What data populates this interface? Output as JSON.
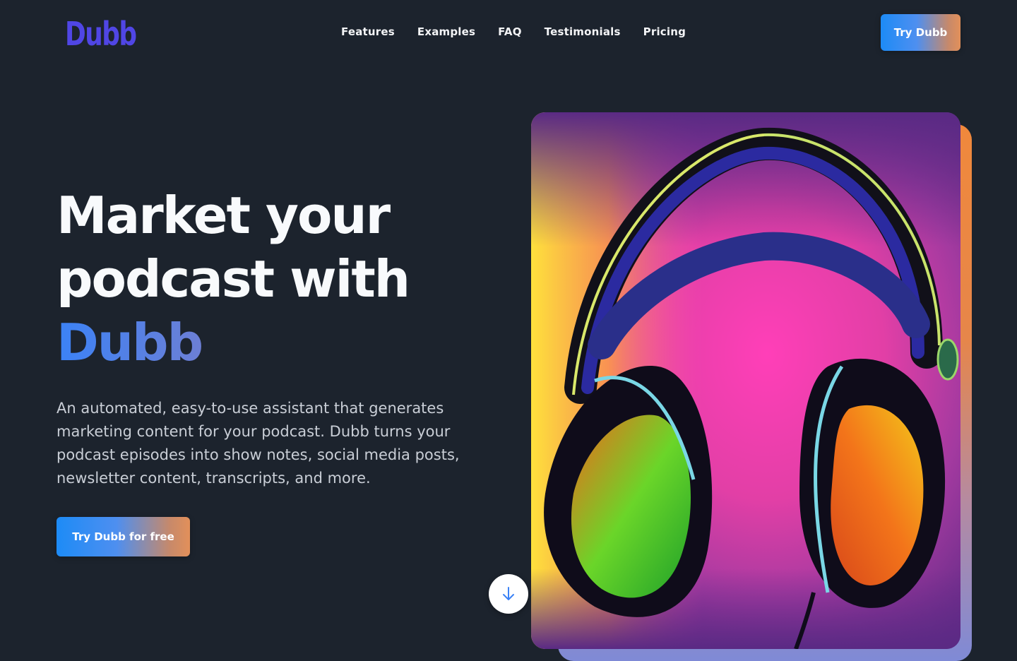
{
  "header": {
    "logo": "Dubb",
    "nav": [
      "Features",
      "Examples",
      "FAQ",
      "Testimonials",
      "Pricing"
    ],
    "cta_label": "Try Dubb"
  },
  "hero": {
    "headline_line1": "Market your",
    "headline_line2": "podcast with",
    "headline_accent": "Dubb",
    "description": "An automated, easy-to-use assistant that generates marketing content for your podcast. Dubb turns your podcast episodes into show notes, social media posts, newsletter content, transcripts, and more.",
    "cta_label": "Try Dubb for free",
    "scroll_icon": "arrow-down-icon",
    "image_subject": "headphones-illustration"
  },
  "colors": {
    "background": "#1c232d",
    "logo": "#5046e5",
    "accent_blue": "#1d8bf6",
    "accent_orange": "#e2905a"
  }
}
